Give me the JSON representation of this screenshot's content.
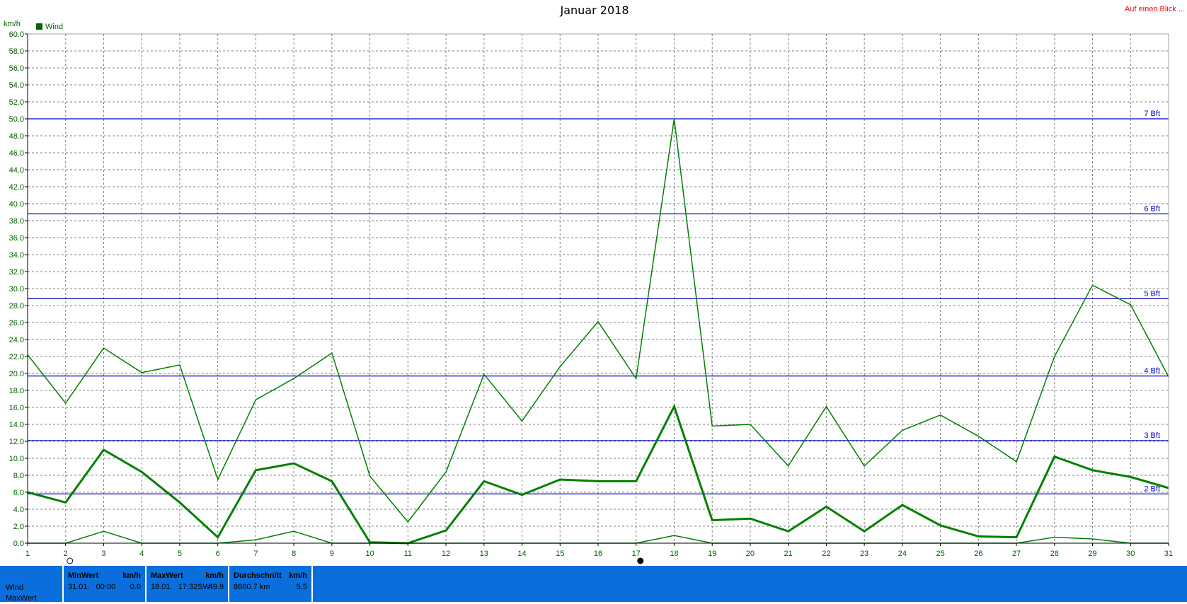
{
  "title": "Januar 2018",
  "link_text": "Auf einen Blick ...",
  "chart_data": {
    "type": "line",
    "title": "Januar 2018",
    "ylabel": "km/h",
    "xlabel": "",
    "ylim": [
      0,
      60
    ],
    "y_tick_step": 2,
    "xlim": [
      1,
      31
    ],
    "x": [
      1,
      2,
      3,
      4,
      5,
      6,
      7,
      8,
      9,
      10,
      11,
      12,
      13,
      14,
      15,
      16,
      17,
      18,
      19,
      20,
      21,
      22,
      23,
      24,
      25,
      26,
      27,
      28,
      29,
      30,
      31
    ],
    "legend": "top-left",
    "legend_entry": "Wind",
    "grid": true,
    "series": [
      {
        "role": "max",
        "values": [
          22.2,
          16.5,
          23.0,
          20.1,
          21.0,
          7.5,
          16.9,
          19.4,
          22.4,
          7.9,
          2.5,
          8.4,
          19.9,
          14.4,
          20.8,
          26.1,
          19.4,
          50.0,
          13.8,
          14.0,
          9.1,
          16.1,
          9.1,
          13.3,
          15.1,
          12.6,
          9.6,
          22.0,
          30.4,
          28.1,
          19.6
        ],
        "color": "#008000",
        "width": 1.5
      },
      {
        "role": "avg",
        "values": [
          6.0,
          4.8,
          11.0,
          8.4,
          4.8,
          0.7,
          8.6,
          9.4,
          7.3,
          0.1,
          0.0,
          1.5,
          7.3,
          5.7,
          7.5,
          7.3,
          7.3,
          16.1,
          2.7,
          2.9,
          1.4,
          4.3,
          1.4,
          4.5,
          2.1,
          0.8,
          0.7,
          10.2,
          8.6,
          7.8,
          6.5
        ],
        "color": "#008000",
        "width": 3
      },
      {
        "role": "min",
        "values": [
          0.0,
          0.0,
          1.4,
          0.0,
          0.0,
          0.0,
          0.4,
          1.4,
          0.0,
          0.0,
          0.0,
          0.0,
          0.0,
          0.0,
          0.0,
          0.0,
          0.0,
          0.9,
          0.0,
          0.0,
          0.0,
          0.0,
          0.0,
          0.0,
          0.0,
          0.0,
          0.0,
          0.7,
          0.5,
          0.0,
          0.0
        ],
        "color": "#008000",
        "width": 1.5
      }
    ],
    "reference_lines": [
      {
        "label": "2 Bft",
        "value": 5.8
      },
      {
        "label": "3 Bft",
        "value": 12.1
      },
      {
        "label": "4 Bft",
        "value": 19.7
      },
      {
        "label": "5 Bft",
        "value": 28.8
      },
      {
        "label": "6 Bft",
        "value": 38.8
      },
      {
        "label": "7 Bft",
        "value": 50.0
      }
    ],
    "reference_color": "#0000c8",
    "axis_color": "#006400",
    "grid_color": "#808080",
    "moon_markers": [
      {
        "day": 2,
        "phase": "full-moon"
      },
      {
        "day": 17,
        "phase": "new-moon"
      }
    ]
  },
  "stats": {
    "rows": [
      "Wind",
      "MaxWert"
    ],
    "cells": [
      {
        "header": "MinWert",
        "unit": "km/h",
        "date": "31.01.",
        "time": "00:00",
        "value": "0.0"
      },
      {
        "header": "MaxWert",
        "unit": "km/h",
        "date": "18.01.",
        "time": "17:32",
        "extra": "SW",
        "value": "49.9"
      },
      {
        "header": "Durchschnitt",
        "unit": "km/h",
        "distance": "8600.7 km",
        "value": "5.5"
      }
    ]
  }
}
